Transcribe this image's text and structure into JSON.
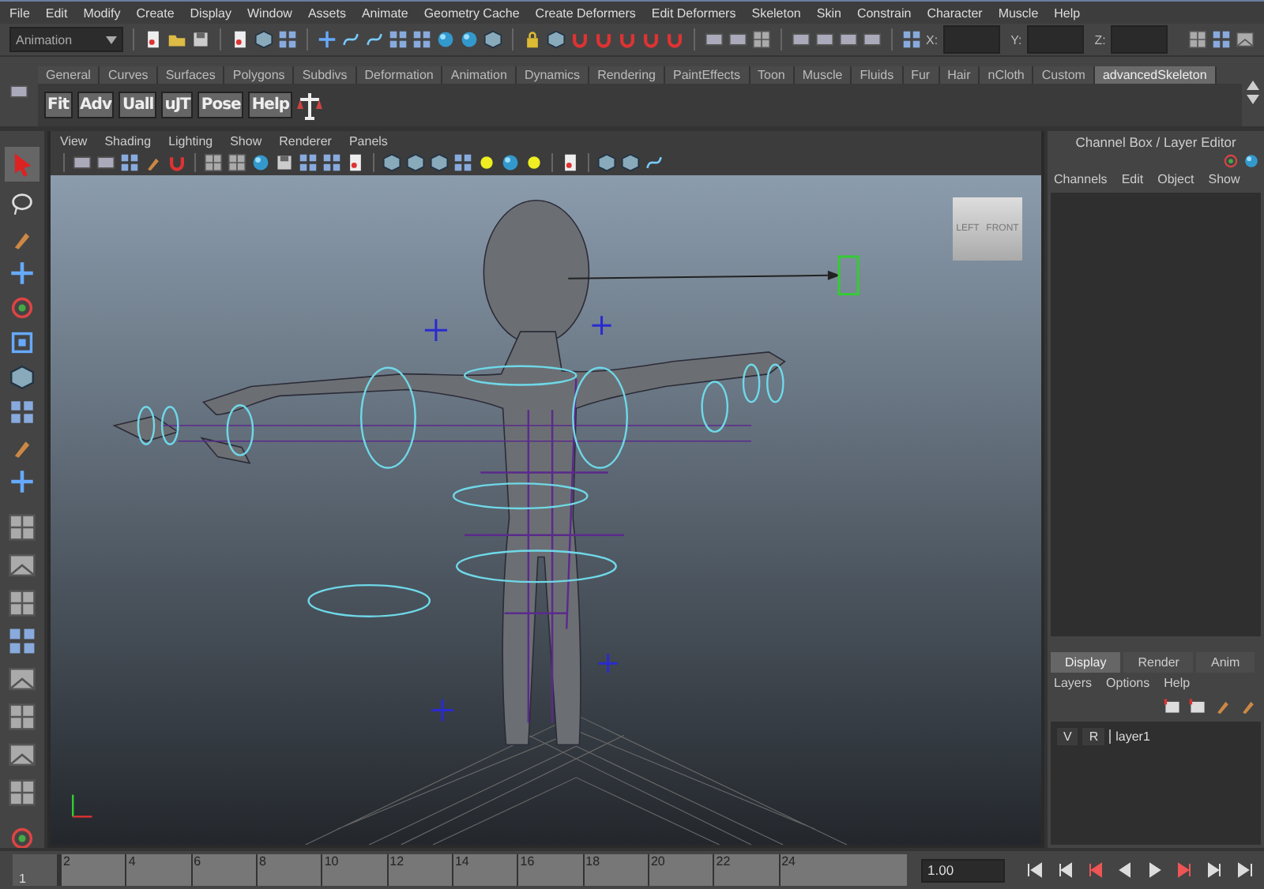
{
  "menu_bar": [
    "File",
    "Edit",
    "Modify",
    "Create",
    "Display",
    "Window",
    "Assets",
    "Animate",
    "Geometry Cache",
    "Create Deformers",
    "Edit Deformers",
    "Skeleton",
    "Skin",
    "Constrain",
    "Character",
    "Muscle",
    "Help"
  ],
  "status_line": {
    "mode": "Animation",
    "fields": [
      {
        "label": "X:"
      },
      {
        "label": "Y:"
      },
      {
        "label": "Z:"
      }
    ]
  },
  "shelf": {
    "tabs": [
      {
        "label": "General",
        "selected": false
      },
      {
        "label": "Curves",
        "selected": false
      },
      {
        "label": "Surfaces",
        "selected": false
      },
      {
        "label": "Polygons",
        "selected": false
      },
      {
        "label": "Subdivs",
        "selected": false
      },
      {
        "label": "Deformation",
        "selected": false
      },
      {
        "label": "Animation",
        "selected": false
      },
      {
        "label": "Dynamics",
        "selected": false
      },
      {
        "label": "Rendering",
        "selected": false
      },
      {
        "label": "PaintEffects",
        "selected": false
      },
      {
        "label": "Toon",
        "selected": false
      },
      {
        "label": "Muscle",
        "selected": false
      },
      {
        "label": "Fluids",
        "selected": false
      },
      {
        "label": "Fur",
        "selected": false
      },
      {
        "label": "Hair",
        "selected": false
      },
      {
        "label": "nCloth",
        "selected": false
      },
      {
        "label": "Custom",
        "selected": false
      },
      {
        "label": "advancedSkeleton",
        "selected": true
      }
    ],
    "buttons": [
      "Fit",
      "Adv",
      "Uall",
      "uJT",
      "Pose",
      "Help"
    ]
  },
  "viewport": {
    "menu": [
      "View",
      "Shading",
      "Lighting",
      "Show",
      "Renderer",
      "Panels"
    ],
    "view_cube": [
      "LEFT",
      "FRONT"
    ]
  },
  "channel_box": {
    "title": "Channel Box / Layer Editor",
    "menu": [
      "Channels",
      "Edit",
      "Object",
      "Show"
    ],
    "layer_tabs": [
      {
        "label": "Display",
        "selected": true
      },
      {
        "label": "Render",
        "selected": false
      },
      {
        "label": "Anim",
        "selected": false
      }
    ],
    "layer_menu": [
      "Layers",
      "Options",
      "Help"
    ],
    "layers": [
      {
        "visible": "V",
        "render": "R",
        "name": "layer1"
      }
    ]
  },
  "time_slider": {
    "start": "1",
    "ticks": [
      "2",
      "4",
      "6",
      "8",
      "10",
      "12",
      "14",
      "16",
      "18",
      "20",
      "22",
      "24"
    ],
    "current_time": "1.00"
  }
}
